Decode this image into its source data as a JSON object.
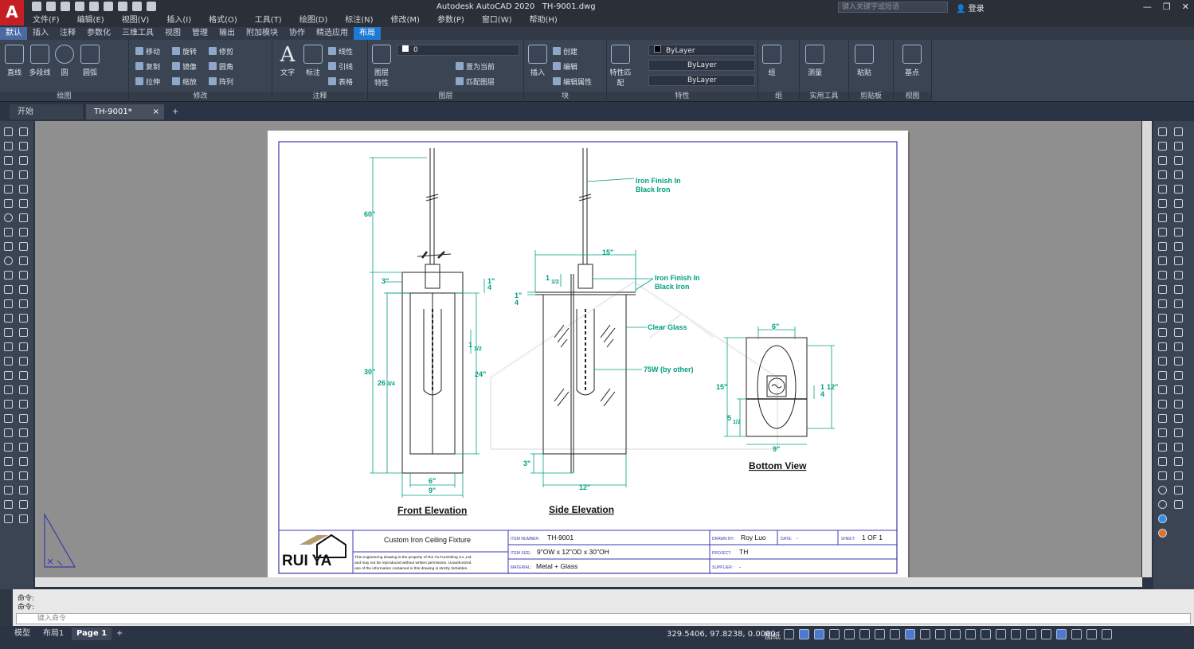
{
  "app": {
    "logo": "A",
    "title": "Autodesk AutoCAD 2020",
    "file": "TH-9001.dwg",
    "search_placeholder": "键入关键字或短语",
    "login": "登录"
  },
  "menu": [
    "文件(F)",
    "编辑(E)",
    "视图(V)",
    "插入(I)",
    "格式(O)",
    "工具(T)",
    "绘图(D)",
    "标注(N)",
    "修改(M)",
    "参数(P)",
    "窗口(W)",
    "帮助(H)"
  ],
  "ribbon_tabs": [
    "默认",
    "插入",
    "注释",
    "参数化",
    "三维工具",
    "视图",
    "管理",
    "输出",
    "附加模块",
    "协作",
    "精选应用",
    "布局"
  ],
  "ribbon": {
    "draw": {
      "label": "绘图",
      "line": "直线",
      "polyline": "多段线",
      "circle": "圆",
      "arc": "圆弧"
    },
    "modify": {
      "label": "修改",
      "move": "移动",
      "rotate": "旋转",
      "trim": "修剪",
      "copy": "复制",
      "mirror": "镜像",
      "fillet": "圆角",
      "stretch": "拉伸",
      "scale": "缩放",
      "array": "阵列"
    },
    "annotation": {
      "label": "注释",
      "text": "文字",
      "dim": "标注",
      "linear": "线性",
      "leader": "引线",
      "table": "表格"
    },
    "layers": {
      "label": "图层",
      "props": "图层特性",
      "current_layer": "0",
      "set_current": "置为当前",
      "match": "匹配图层"
    },
    "block": {
      "label": "块",
      "insert": "插入",
      "create": "创建",
      "edit": "编辑",
      "edit_attr": "编辑属性"
    },
    "properties": {
      "label": "特性",
      "match": "特性匹配",
      "color": "ByLayer",
      "linetype": "ByLayer",
      "lineweight": "ByLayer"
    },
    "groups": {
      "label": "组",
      "group": "组"
    },
    "utilities": {
      "label": "实用工具",
      "measure": "测量"
    },
    "clipboard": {
      "label": "剪贴板",
      "paste": "粘贴"
    },
    "view": {
      "label": "视图",
      "base": "基点"
    }
  },
  "doc_tabs": {
    "start": "开始",
    "file": "TH-9001*"
  },
  "drawing": {
    "dims_front": {
      "d60": "60\"",
      "d3": "3\"",
      "d30": "30\"",
      "d26": "26",
      "d26f": "3/4",
      "d24": "24\"",
      "d1a": "1\"",
      "d1b": "4",
      "d1h": "1",
      "d1hf": "1/2",
      "d6": "6\"",
      "d9": "9\""
    },
    "dims_side": {
      "d15": "15\"",
      "d1h": "1",
      "d1hf": "1/2",
      "d14a": "1\"",
      "d14b": "4",
      "d3": "3\"",
      "d12": "12\""
    },
    "dims_bottom": {
      "d6": "6\"",
      "d15": "15\"",
      "d5": "5",
      "d5f": "1/2",
      "d12a": "1",
      "d12b": "12\"",
      "d12c": "4",
      "d9": "9\""
    },
    "notes": {
      "iron1a": "Iron Finish In",
      "iron1b": "Black Iron",
      "iron2a": "Iron Finish In",
      "iron2b": "Black Iron",
      "glass": "Clear Glass",
      "bulb": "75W (by other)"
    },
    "views": {
      "front": "Front Elevation",
      "side": "Side Elevation",
      "bottom": "Bottom View"
    },
    "titleblock": {
      "logo": "RUI YA",
      "product": "Custom Iron Ceiling Fixture",
      "disclaimer1": "This engineering drawing is the property of Rui Ya Furnishing Co.,Ltd.",
      "disclaimer2": "and may not be reproduced without written permission. Unauthorized",
      "disclaimer3": "use of the information contained in this drawing is strictly forbidden.",
      "item_number_label": "ITEM NUMBER:",
      "item_number": "TH-9001",
      "item_size_label": "ITEM SIZE:",
      "item_size": "9\"OW x 12\"OD x 30\"OH",
      "material_label": "MATERIAL:",
      "material": "Metal + Glass",
      "drawn_by_label": "DRAWN BY:",
      "drawn_by": "Roy Luo",
      "date_label": "DATE:",
      "date": "-",
      "sheet_label": "SHEET:",
      "sheet": "1 OF 1",
      "project_label": "PROJECT:",
      "project": "TH",
      "supplier_label": "SUPPLIER:",
      "supplier": "-"
    }
  },
  "command": {
    "line1": "命令:",
    "line2": "命令:",
    "placeholder": "键入命令"
  },
  "layouts": [
    "模型",
    "布局1",
    "Page 1"
  ],
  "coords": "329.5406, 97.8238, 0.0000",
  "status_paper": "图纸"
}
